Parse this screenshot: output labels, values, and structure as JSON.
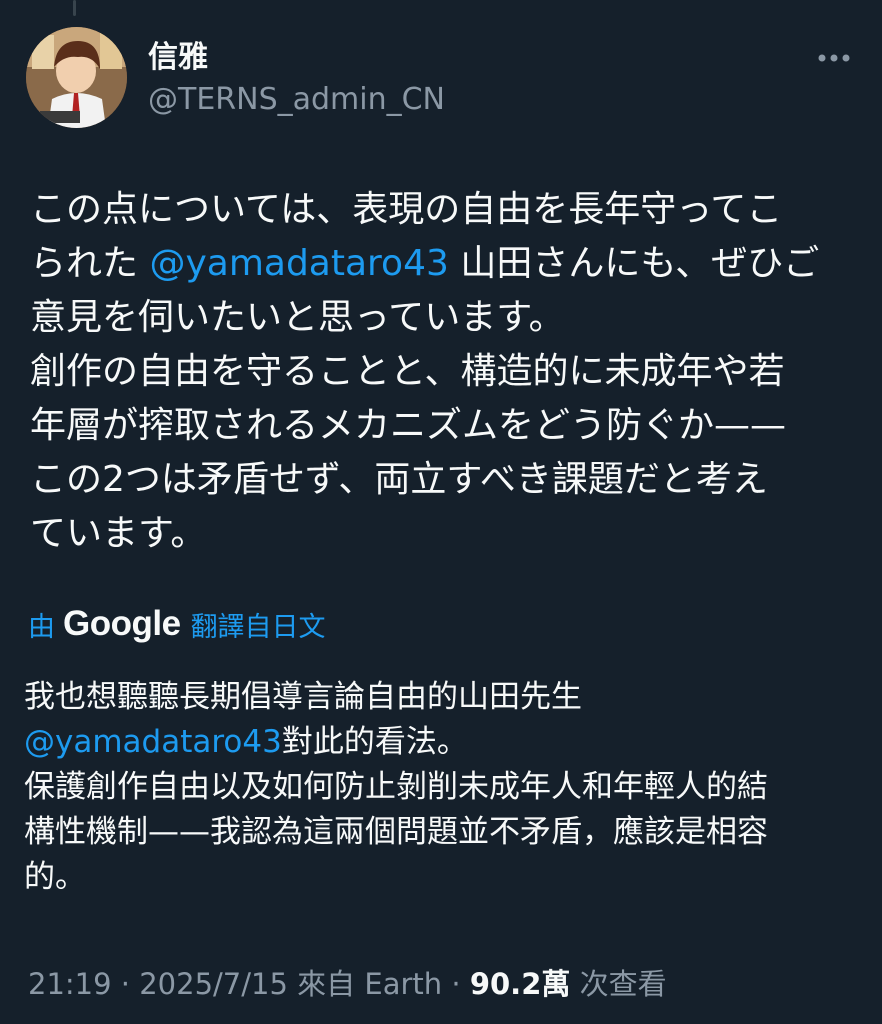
{
  "author": {
    "display_name": "信雅",
    "handle": "@TERNS_admin_CN"
  },
  "icons": {
    "more": "more-horizontal-icon",
    "avatar": "avatar-image"
  },
  "tweet": {
    "lines": [
      {
        "before": "この点については、表現の自由を長年守ってこ",
        "mention": "",
        "after": ""
      },
      {
        "before": "られた ",
        "mention": "@yamadataro43",
        "after": " 山田さんにも、ぜひご"
      },
      {
        "before": "意見を伺いたいと思っています。",
        "mention": "",
        "after": ""
      },
      {
        "before": "創作の自由を守ることと、構造的に未成年や若",
        "mention": "",
        "after": ""
      },
      {
        "before": "年層が搾取されるメカニズムをどう防ぐか——",
        "mention": "",
        "after": ""
      },
      {
        "before": "この2つは矛盾せず、両立すべき課題だと考え",
        "mention": "",
        "after": ""
      },
      {
        "before": "ています。",
        "mention": "",
        "after": ""
      }
    ]
  },
  "translation": {
    "by_label": "由",
    "provider": "Google",
    "from_label": "翻譯自日文",
    "lines": [
      {
        "before": "我也想聽聽長期倡導言論自由的山田先生",
        "mention": "",
        "after": ""
      },
      {
        "before": "",
        "mention": "@yamadataro43",
        "after": "對此的看法。"
      },
      {
        "before": "保護創作自由以及如何防止剝削未成年人和年輕人的結",
        "mention": "",
        "after": ""
      },
      {
        "before": "構性機制——我認為這兩個問題並不矛盾，應該是相容",
        "mention": "",
        "after": ""
      },
      {
        "before": "的。",
        "mention": "",
        "after": ""
      }
    ]
  },
  "meta": {
    "time": "21:19",
    "separator": " · ",
    "date": "2025/7/15",
    "source_prefix": "來自",
    "source": "Earth",
    "views_count": "90.2萬",
    "views_label": "次查看"
  },
  "colors": {
    "background": "#15202b",
    "text": "#f7f9f9",
    "secondary": "#8b98a5",
    "link": "#1d9bf0"
  }
}
